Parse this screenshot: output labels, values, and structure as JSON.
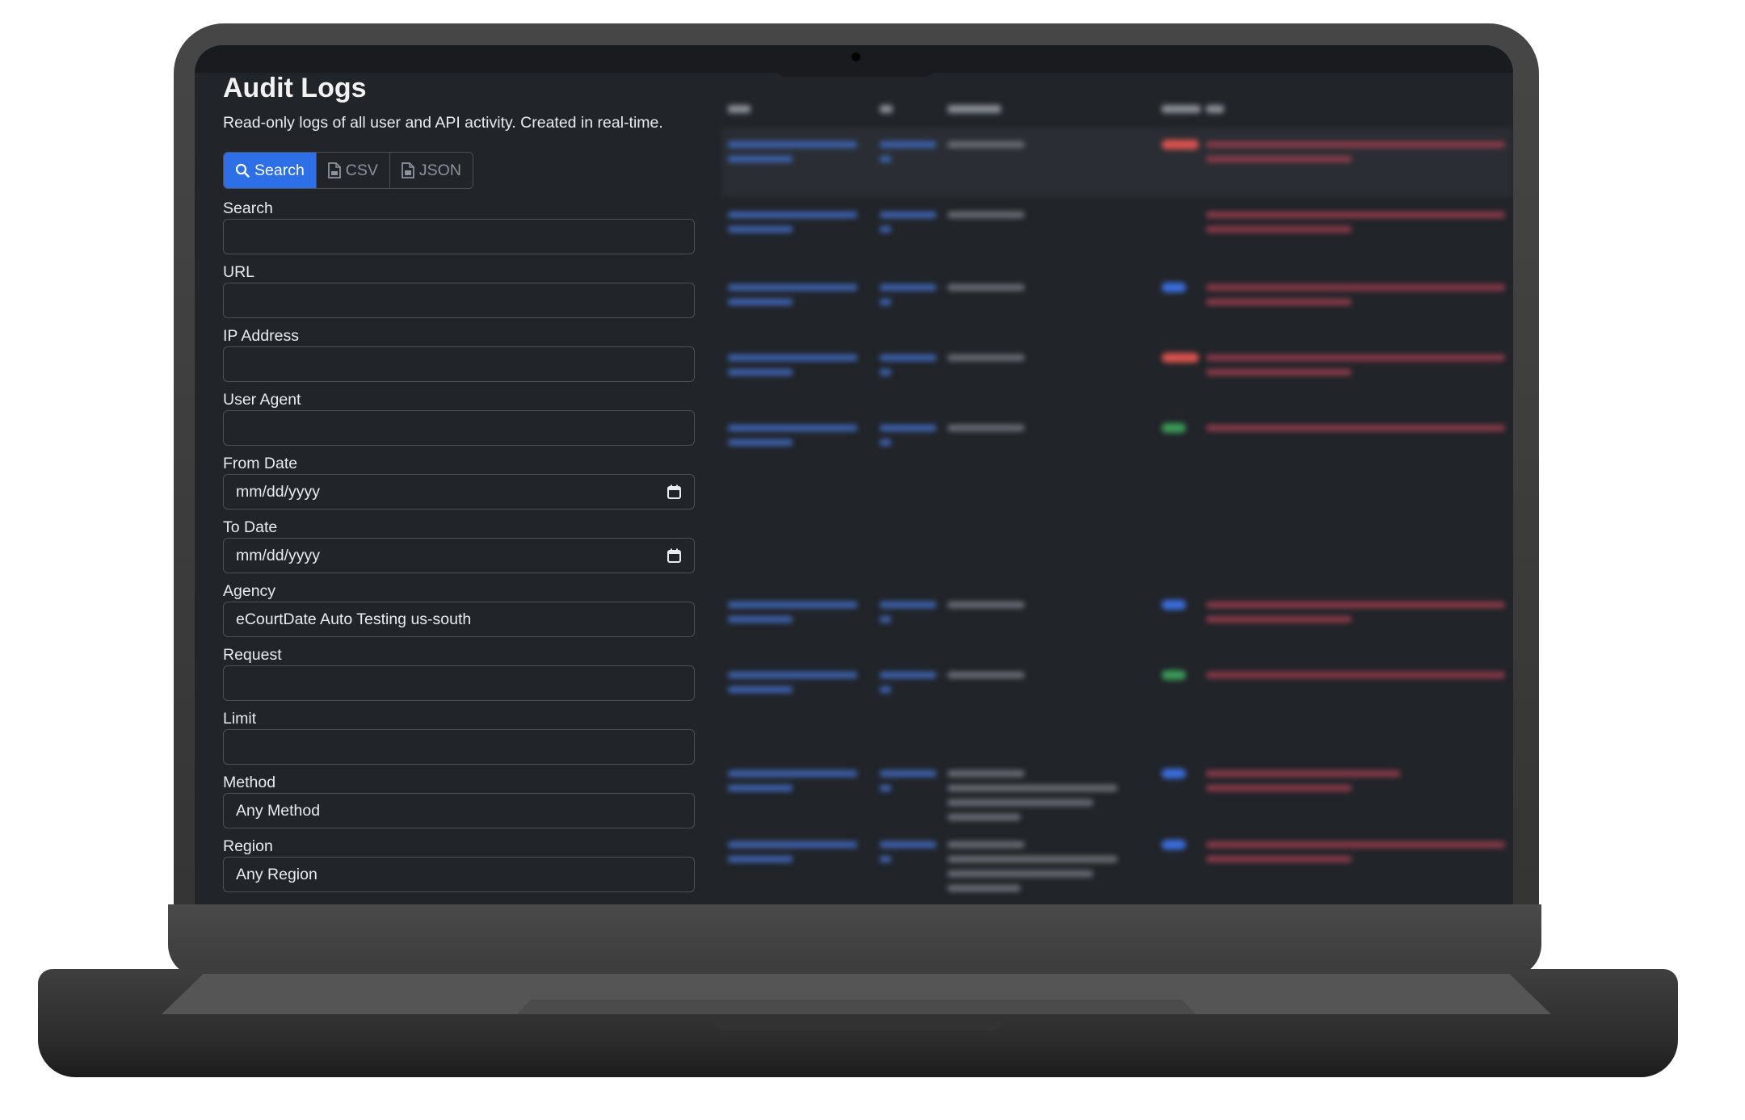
{
  "page": {
    "title": "Audit Logs",
    "subtitle": "Read-only logs of all user and API activity. Created in real-time."
  },
  "toolbar": {
    "search_label": "Search",
    "csv_label": "CSV",
    "json_label": "JSON"
  },
  "form": {
    "search": {
      "label": "Search",
      "value": ""
    },
    "url": {
      "label": "URL",
      "value": ""
    },
    "ip": {
      "label": "IP Address",
      "value": ""
    },
    "user_agent": {
      "label": "User Agent",
      "value": ""
    },
    "from_date": {
      "label": "From Date",
      "placeholder": "mm/dd/yyyy"
    },
    "to_date": {
      "label": "To Date",
      "placeholder": "mm/dd/yyyy"
    },
    "agency": {
      "label": "Agency",
      "value": "eCourtDate Auto Testing us-south"
    },
    "request": {
      "label": "Request",
      "value": ""
    },
    "limit": {
      "label": "Limit",
      "value": ""
    },
    "method": {
      "label": "Method",
      "value": "Any Method"
    },
    "region": {
      "label": "Region",
      "value": "Any Region"
    }
  },
  "colors": {
    "accent": "#2c6fe6",
    "background": "#212429",
    "method_red": "#d9534f",
    "method_blue": "#3b6fe0",
    "method_green": "#3a9a57"
  },
  "icons": [
    "search-icon",
    "csv-file-icon",
    "json-file-icon",
    "calendar-icon"
  ]
}
